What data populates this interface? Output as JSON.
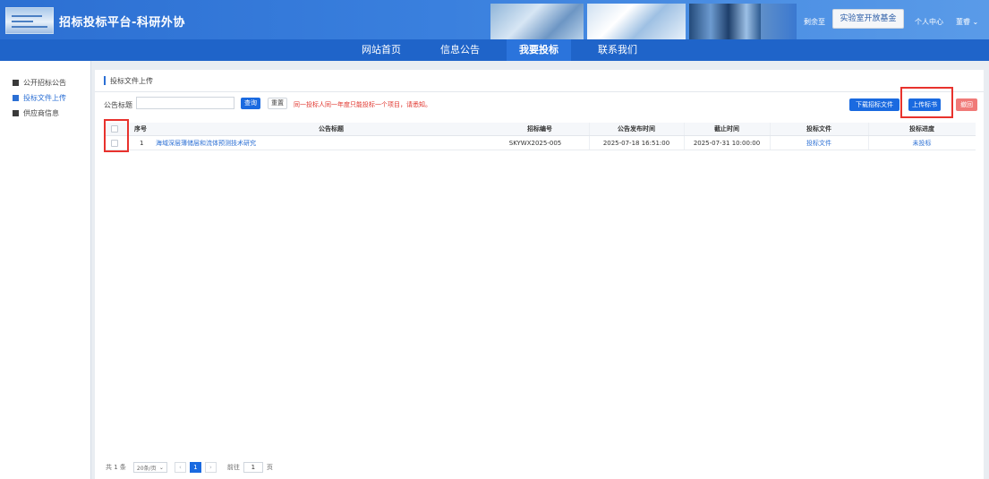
{
  "header": {
    "title": "招标投标平台-科研外协",
    "countdown_label": "剩余至",
    "fund_button": "实验室开放基金",
    "user_center": "个人中心",
    "user_name": "董睿 ⌄",
    "logo_icon": "platform-logo-icon"
  },
  "nav": {
    "items": [
      {
        "label": "网站首页"
      },
      {
        "label": "信息公告"
      },
      {
        "label": "我要投标"
      },
      {
        "label": "联系我们"
      }
    ],
    "active": "我要投标"
  },
  "sidebar": {
    "items": [
      {
        "label": "公开招标公告"
      },
      {
        "label": "投标文件上传"
      },
      {
        "label": "供应商信息"
      }
    ],
    "active": "投标文件上传"
  },
  "main": {
    "breadcrumb": "投标文件上传",
    "filter": {
      "label": "公告标题",
      "value": "",
      "placeholder": "",
      "query_button": "查询",
      "reset_button": "重置",
      "notice": "同一投标人同一年度只能投标一个项目，请悉知。"
    },
    "actions": {
      "download": "下载招标文件",
      "upload": "上传标书",
      "withdraw": "撤回"
    },
    "table": {
      "columns": [
        "序号",
        "公告标题",
        "招标编号",
        "公告发布时间",
        "截止时间",
        "投标文件",
        "投标进度"
      ],
      "rows": [
        {
          "index": "1",
          "title": "海域深层薄储层和流体预测技术研究",
          "code": "SKYWX2025-005",
          "publish_time": "2025-07-18 16:51:00",
          "deadline": "2025-07-31 10:00:00",
          "file": "投标文件",
          "progress": "未投标"
        }
      ]
    },
    "pager": {
      "total": "共 1 条",
      "page_size": "20条/页",
      "current_page": "1",
      "goto_label": "前往",
      "goto_value": "1",
      "page_suffix": "页",
      "prev": "‹",
      "next": "›"
    }
  },
  "colors": {
    "header_blue": "#2c6fd2",
    "nav_blue": "#1f64c9",
    "primary": "#1a6ae0",
    "danger_notice": "#e0342c",
    "highlight_box": "#e8322d",
    "withdraw": "#f07a78"
  }
}
